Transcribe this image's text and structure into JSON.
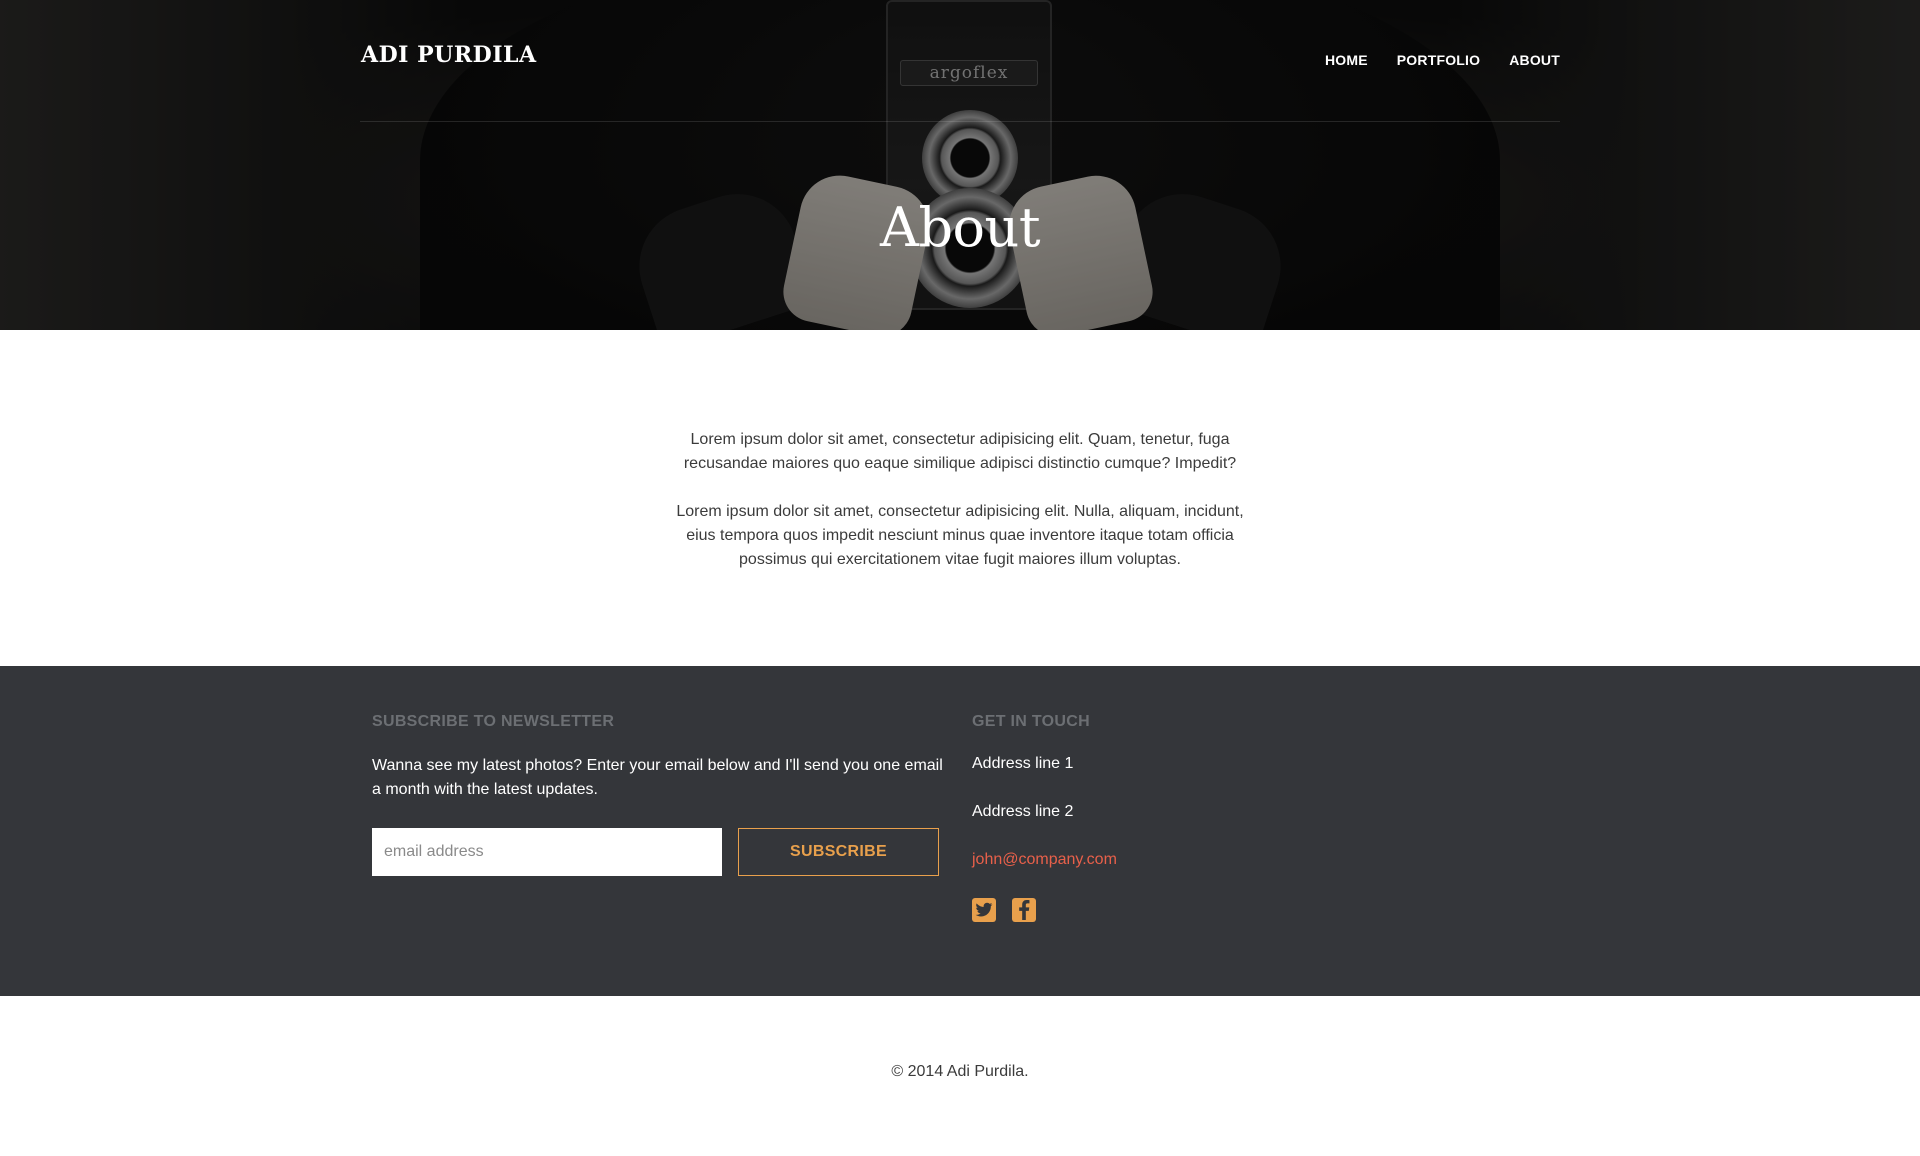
{
  "header": {
    "brand": "ADI PURDILA",
    "nav": [
      "HOME",
      "PORTFOLIO",
      "ABOUT"
    ],
    "camera_label": "argoflex"
  },
  "hero": {
    "title": "About"
  },
  "content": {
    "paragraphs": [
      "Lorem ipsum dolor sit amet, consectetur adipisicing elit. Quam, tenetur, fuga recusandae maiores quo eaque similique adipisci distinctio cumque? Impedit?",
      "Lorem ipsum dolor sit amet, consectetur adipisicing elit. Nulla, aliquam, incidunt, eius tempora quos impedit nesciunt minus quae inventore itaque totam officia possimus qui exercitationem vitae fugit maiores illum voluptas."
    ]
  },
  "footer": {
    "newsletter": {
      "heading": "SUBSCRIBE TO NEWSLETTER",
      "description": "Wanna see my latest photos? Enter your email below and I'll send you one email a month with the latest updates.",
      "email_placeholder": "email address",
      "email_value": "",
      "button_label": "SUBSCRIBE"
    },
    "contact": {
      "heading": "GET IN TOUCH",
      "address_line_1": "Address line 1",
      "address_line_2": "Address line 2",
      "email": "john@company.com",
      "socials": [
        "twitter-icon",
        "facebook-icon"
      ]
    }
  },
  "copyright": "© 2014 Adi Purdila.",
  "colors": {
    "accent": "#e8a04c",
    "link": "#e8604a",
    "footer_bg": "#34363a",
    "footer_heading": "#6c6f73"
  }
}
